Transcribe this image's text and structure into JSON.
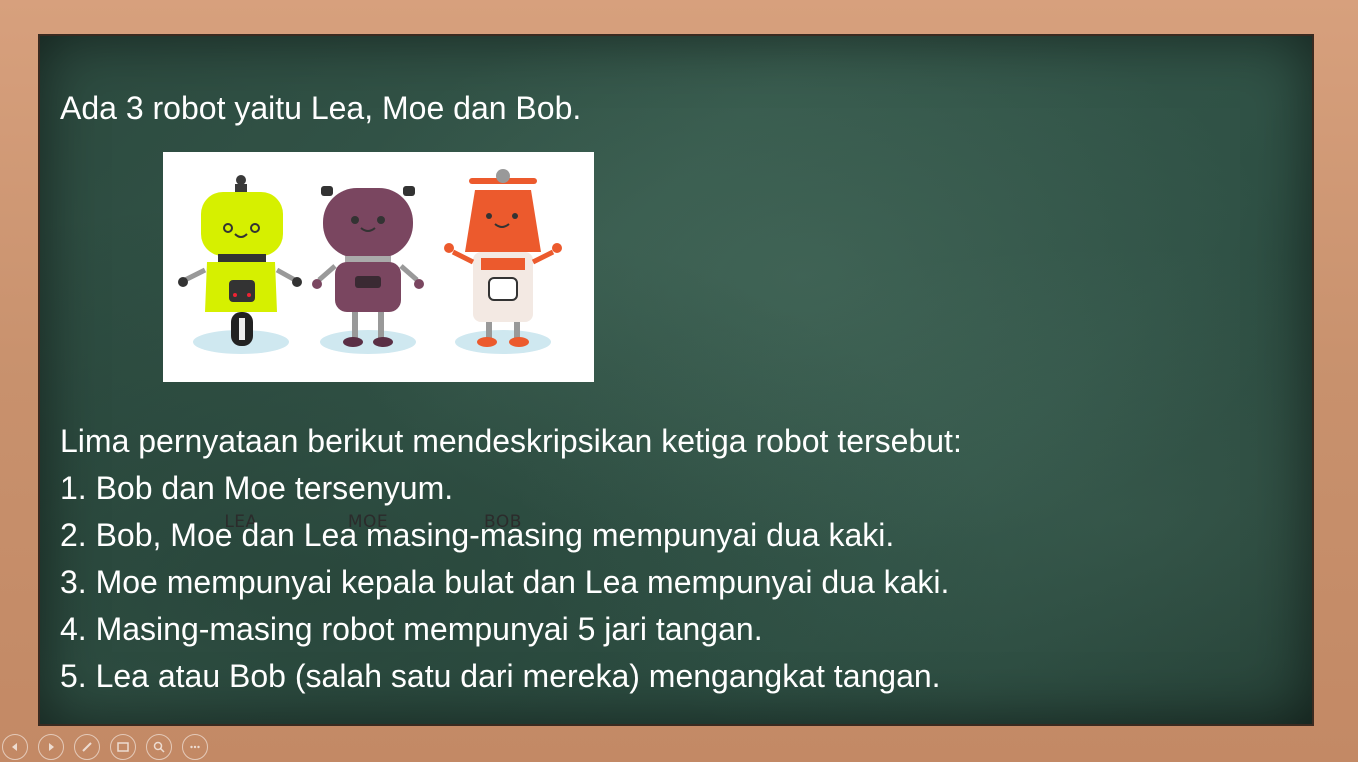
{
  "slide": {
    "intro_text": "Ada 3 robot yaitu Lea, Moe dan Bob.",
    "robots": [
      {
        "name": "LEA",
        "color": "#d6f000"
      },
      {
        "name": "MOE",
        "color": "#7a4660"
      },
      {
        "name": "BOB",
        "color": "#ec5a2d"
      }
    ],
    "lines": [
      "Lima pernyataan berikut mendeskripsikan ketiga robot tersebut:",
      "1. Bob dan Moe tersenyum.",
      "2. Bob, Moe dan Lea masing-masing mempunyai dua kaki.",
      "3. Moe mempunyai kepala bulat dan Lea mempunyai dua kaki.",
      "4. Masing-masing robot mempunyai 5 jari tangan.",
      "5. Lea atau Bob (salah satu dari mereka) mengangkat tangan."
    ]
  },
  "toolbar": {
    "icons": [
      "previous-icon",
      "next-icon",
      "pen-icon",
      "slides-grid-icon",
      "zoom-icon",
      "more-icon"
    ]
  },
  "colors": {
    "board": "#2f5145",
    "frame": "#c98f6c",
    "text": "#ffffff"
  }
}
